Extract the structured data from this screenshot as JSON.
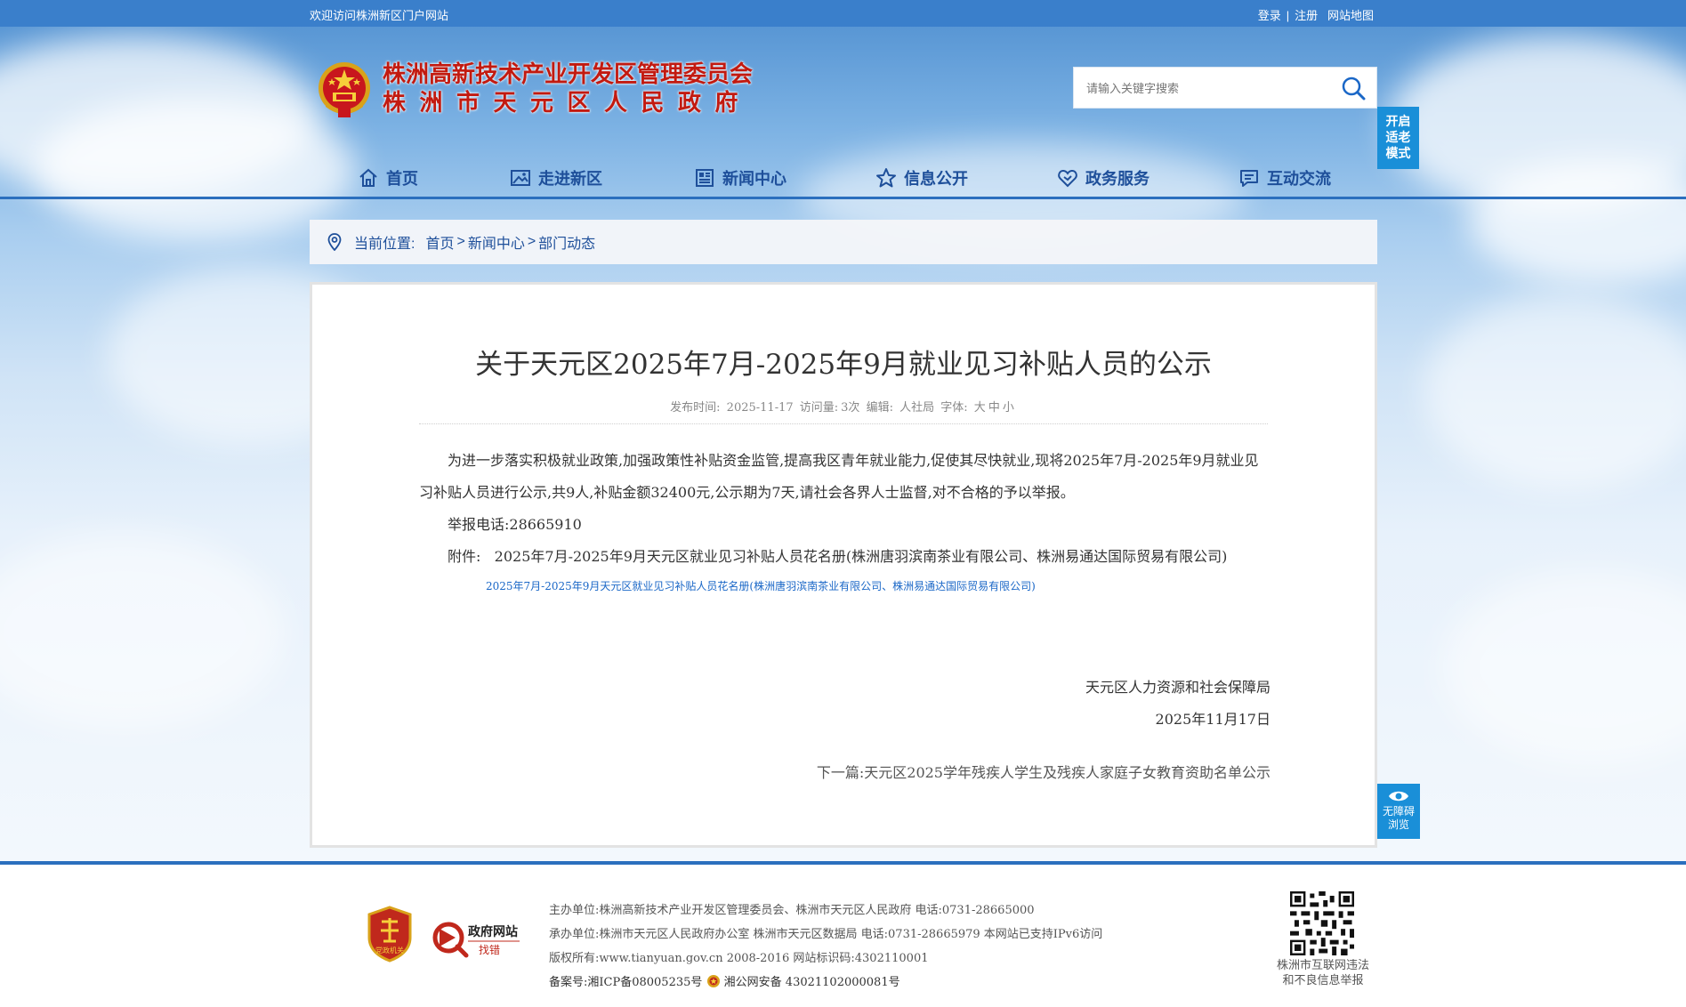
{
  "topbar": {
    "welcome": "欢迎访问株洲新区门户网站",
    "login": "登录",
    "register": "注册",
    "sitemap": "网站地图"
  },
  "header": {
    "title_line1": "株洲高新技术产业开发区管理委员会",
    "title_line2": "株洲市天元区人民政府",
    "search_placeholder": "请输入关键字搜索",
    "elder_mode": [
      "开启",
      "适老",
      "模式"
    ]
  },
  "nav": [
    {
      "label": "首页",
      "icon": "home-icon"
    },
    {
      "label": "走进新区",
      "icon": "picture-icon"
    },
    {
      "label": "新闻中心",
      "icon": "newspaper-icon"
    },
    {
      "label": "信息公开",
      "icon": "star-icon"
    },
    {
      "label": "政务服务",
      "icon": "heart-icon"
    },
    {
      "label": "互动交流",
      "icon": "chat-icon"
    }
  ],
  "breadcrumb": {
    "label": "当前位置:",
    "items": [
      "首页",
      "新闻中心",
      "部门动态"
    ]
  },
  "article": {
    "title": "关于天元区2025年7月-2025年9月就业见习补贴人员的公示",
    "meta": {
      "date_label": "发布时间:",
      "date": "2025-11-17",
      "visits_label": "访问量:",
      "visits": "3次",
      "editor_label": "编辑:",
      "editor": "人社局",
      "font_label": "字体:",
      "font_sizes": [
        "大",
        "中",
        "小"
      ]
    },
    "paragraph1": "为进一步落实积极就业政策,加强政策性补贴资金监管,提高我区青年就业能力,促使其尽快就业,现将2025年7月-2025年9月就业见习补贴人员进行公示,共9人,补贴金额32400元,公示期为7天,请社会各界人士监督,对不合格的予以举报。",
    "report": "举报电话:28665910",
    "attachment_label": "附件:",
    "attachment_name": "2025年7月-2025年9月天元区就业见习补贴人员花名册(株洲唐羽滨南茶业有限公司、株洲易通达国际贸易有限公司)",
    "attachment_link": "2025年7月-2025年9月天元区就业见习补贴人员花名册(株洲唐羽滨南茶业有限公司、株洲易通达国际贸易有限公司)",
    "signature_org": "天元区人力资源和社会保障局",
    "signature_date": "2025年11月17日",
    "next_label": "下一篇:",
    "next_title": "天元区2025学年残疾人学生及残疾人家庭子女教育资助名单公示"
  },
  "accessibility": [
    "无障碍",
    "浏览"
  ],
  "footer": {
    "badge1_text": "党政机关",
    "badge2_line1": "政府网站",
    "badge2_line2": "找错",
    "line1": "主办单位:株洲高新技术产业开发区管理委员会、株洲市天元区人民政府 电话:0731-28665000",
    "line2": "承办单位:株洲市天元区人民政府办公室 株洲市天元区数据局 电话:0731-28665979 本网站已支持IPv6访问",
    "line3": "版权所有:www.tianyuan.gov.cn 2008-2016 网站标识码:4302110001",
    "icp": "备案号:湘ICP备08005235号",
    "police": "湘公网安备 43021102000081号",
    "qr_caption_1": "株洲市互联网违法",
    "qr_caption_2": "和不良信息举报"
  },
  "colors": {
    "accent_blue": "#2b6fbe",
    "title_red": "#c21a10",
    "side_button": "#1a8fd8"
  }
}
